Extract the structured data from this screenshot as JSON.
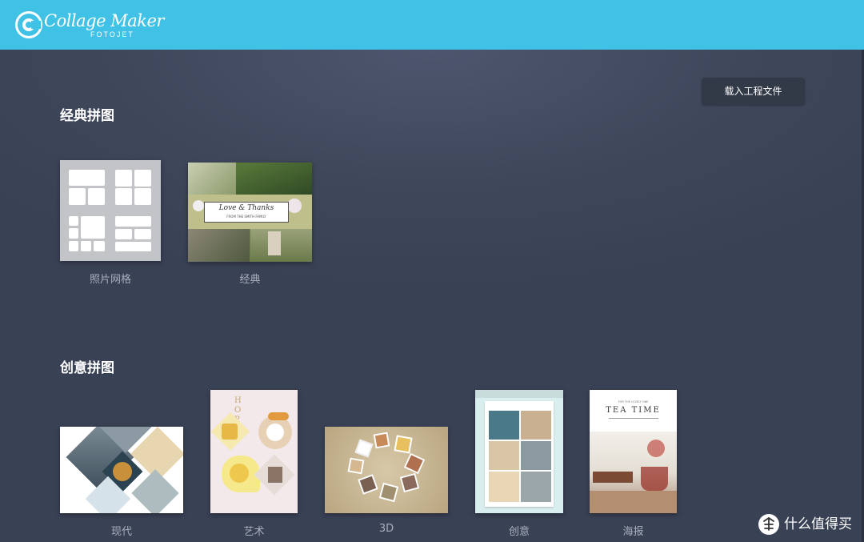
{
  "app": {
    "logo_name": "Collage Maker",
    "logo_brand": "FOTOJET",
    "accent_color": "#40c1e6",
    "logo_icon": "c-logo-icon"
  },
  "toolbar": {
    "load_project_label": "载入工程文件"
  },
  "sections": {
    "classic": {
      "title": "经典拼图",
      "items": [
        {
          "label": "照片网格"
        },
        {
          "label": "经典",
          "banner_title": "Love & Thanks",
          "banner_sub": "FROM THE SMITH FAMILY"
        }
      ]
    },
    "creative": {
      "title": "创意拼图",
      "items": [
        {
          "label": "现代"
        },
        {
          "label": "艺术",
          "poster_text": "HOPE"
        },
        {
          "label": "3D"
        },
        {
          "label": "创意"
        },
        {
          "label": "海报",
          "poster_kicker": "FOR THE LOVELY ONE",
          "poster_title": "TEA TIME"
        }
      ]
    }
  },
  "watermark": {
    "text": "什么值得买",
    "icon": "zhi-icon"
  }
}
